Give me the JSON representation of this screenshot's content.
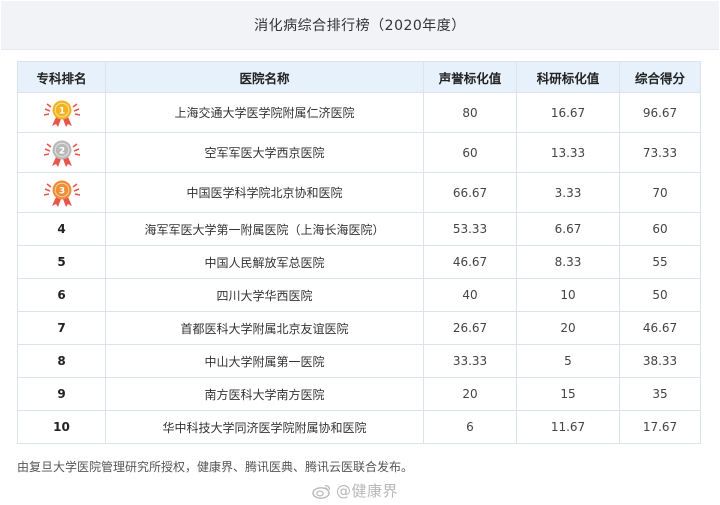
{
  "title": "消化病综合排行榜（2020年度）",
  "columns": [
    "专科排名",
    "医院名称",
    "声誉标化值",
    "科研标化值",
    "综合得分"
  ],
  "rows": [
    {
      "rank": "1",
      "name": "上海交通大学医学院附属仁济医院",
      "reputation": "80",
      "research": "16.67",
      "score": "96.67"
    },
    {
      "rank": "2",
      "name": "空军军医大学西京医院",
      "reputation": "60",
      "research": "13.33",
      "score": "73.33"
    },
    {
      "rank": "3",
      "name": "中国医学科学院北京协和医院",
      "reputation": "66.67",
      "research": "3.33",
      "score": "70"
    },
    {
      "rank": "4",
      "name": "海军军医大学第一附属医院（上海长海医院）",
      "reputation": "53.33",
      "research": "6.67",
      "score": "60"
    },
    {
      "rank": "5",
      "name": "中国人民解放军总医院",
      "reputation": "46.67",
      "research": "8.33",
      "score": "55"
    },
    {
      "rank": "6",
      "name": "四川大学华西医院",
      "reputation": "40",
      "research": "10",
      "score": "50"
    },
    {
      "rank": "7",
      "name": "首都医科大学附属北京友谊医院",
      "reputation": "26.67",
      "research": "20",
      "score": "46.67"
    },
    {
      "rank": "8",
      "name": "中山大学附属第一医院",
      "reputation": "33.33",
      "research": "5",
      "score": "38.33"
    },
    {
      "rank": "9",
      "name": "南方医科大学南方医院",
      "reputation": "20",
      "research": "15",
      "score": "35"
    },
    {
      "rank": "10",
      "name": "华中科技大学同济医学院附属协和医院",
      "reputation": "6",
      "research": "11.67",
      "score": "17.67"
    }
  ],
  "medal_colors": {
    "gold": "#f3b321",
    "silver": "#b9b9b9",
    "bronze": "#ee8d35",
    "ribbon": "#e8554a"
  },
  "footnote": "由复旦大学医院管理研究所授权，健康界、腾讯医典、腾讯云医联合发布。",
  "watermark": "@健康界",
  "watermark_icon": "weibo-icon"
}
